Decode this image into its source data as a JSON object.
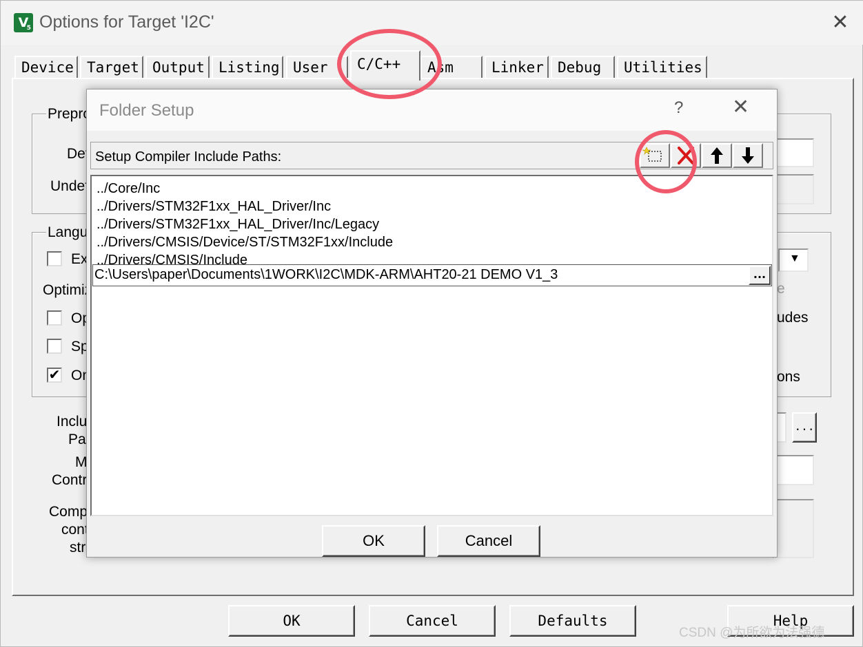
{
  "outer_window": {
    "title": "Options for Target 'I2C'",
    "close_glyph": "✕",
    "tabs": [
      {
        "label": "Device"
      },
      {
        "label": "Target"
      },
      {
        "label": "Output"
      },
      {
        "label": "Listing"
      },
      {
        "label": "User"
      },
      {
        "label": "C/C++",
        "active": true
      },
      {
        "label": "Asm"
      },
      {
        "label": "Linker"
      },
      {
        "label": "Debug"
      },
      {
        "label": "Utilities"
      }
    ],
    "background_fragments": {
      "preprocessor_group": "Prepro",
      "define_label": "Def",
      "undefine_label": "Undef",
      "language_group": "Langu",
      "execute_only_label": "Ex",
      "optimization_label": "Optimiz",
      "opt_label": "Op",
      "split_label": "Sp",
      "one_elf_label": "On",
      "one_elf_checked": true,
      "include_paths_label_1": "Inclu",
      "include_paths_label_2": "Pat",
      "misc_label_1": "M",
      "misc_label_2": "Contr",
      "compiler_label_1": "Comp",
      "compiler_label_2": "cont",
      "compiler_label_3": "stri",
      "right_frag_1": "e",
      "right_frag_2": "udes",
      "right_frag_3": "ons",
      "dropdown_arrow": "▼",
      "browse_glyph": "..."
    },
    "buttons": {
      "ok": "OK",
      "cancel": "Cancel",
      "defaults": "Defaults",
      "help": "Help"
    }
  },
  "folder_setup": {
    "title": "Folder Setup",
    "help_glyph": "?",
    "close_glyph": "✕",
    "label": "Setup Compiler Include Paths:",
    "toolbar_icons": [
      "new-folder-icon",
      "delete-icon",
      "move-up-icon",
      "move-down-icon"
    ],
    "paths": [
      "../Core/Inc",
      "../Drivers/STM32F1xx_HAL_Driver/Inc",
      "../Drivers/STM32F1xx_HAL_Driver/Inc/Legacy",
      "../Drivers/CMSIS/Device/ST/STM32F1xx/Include",
      "../Drivers/CMSIS/Include"
    ],
    "edit_value": "C:\\Users\\paper\\Documents\\1WORK\\I2C\\MDK-ARM\\AHT20-21 DEMO V1_3",
    "browse_label": "...",
    "ok_label": "OK",
    "cancel_label": "Cancel"
  },
  "annotation_color": "#f0596b",
  "watermark": "CSDN @为所欲为法强德"
}
